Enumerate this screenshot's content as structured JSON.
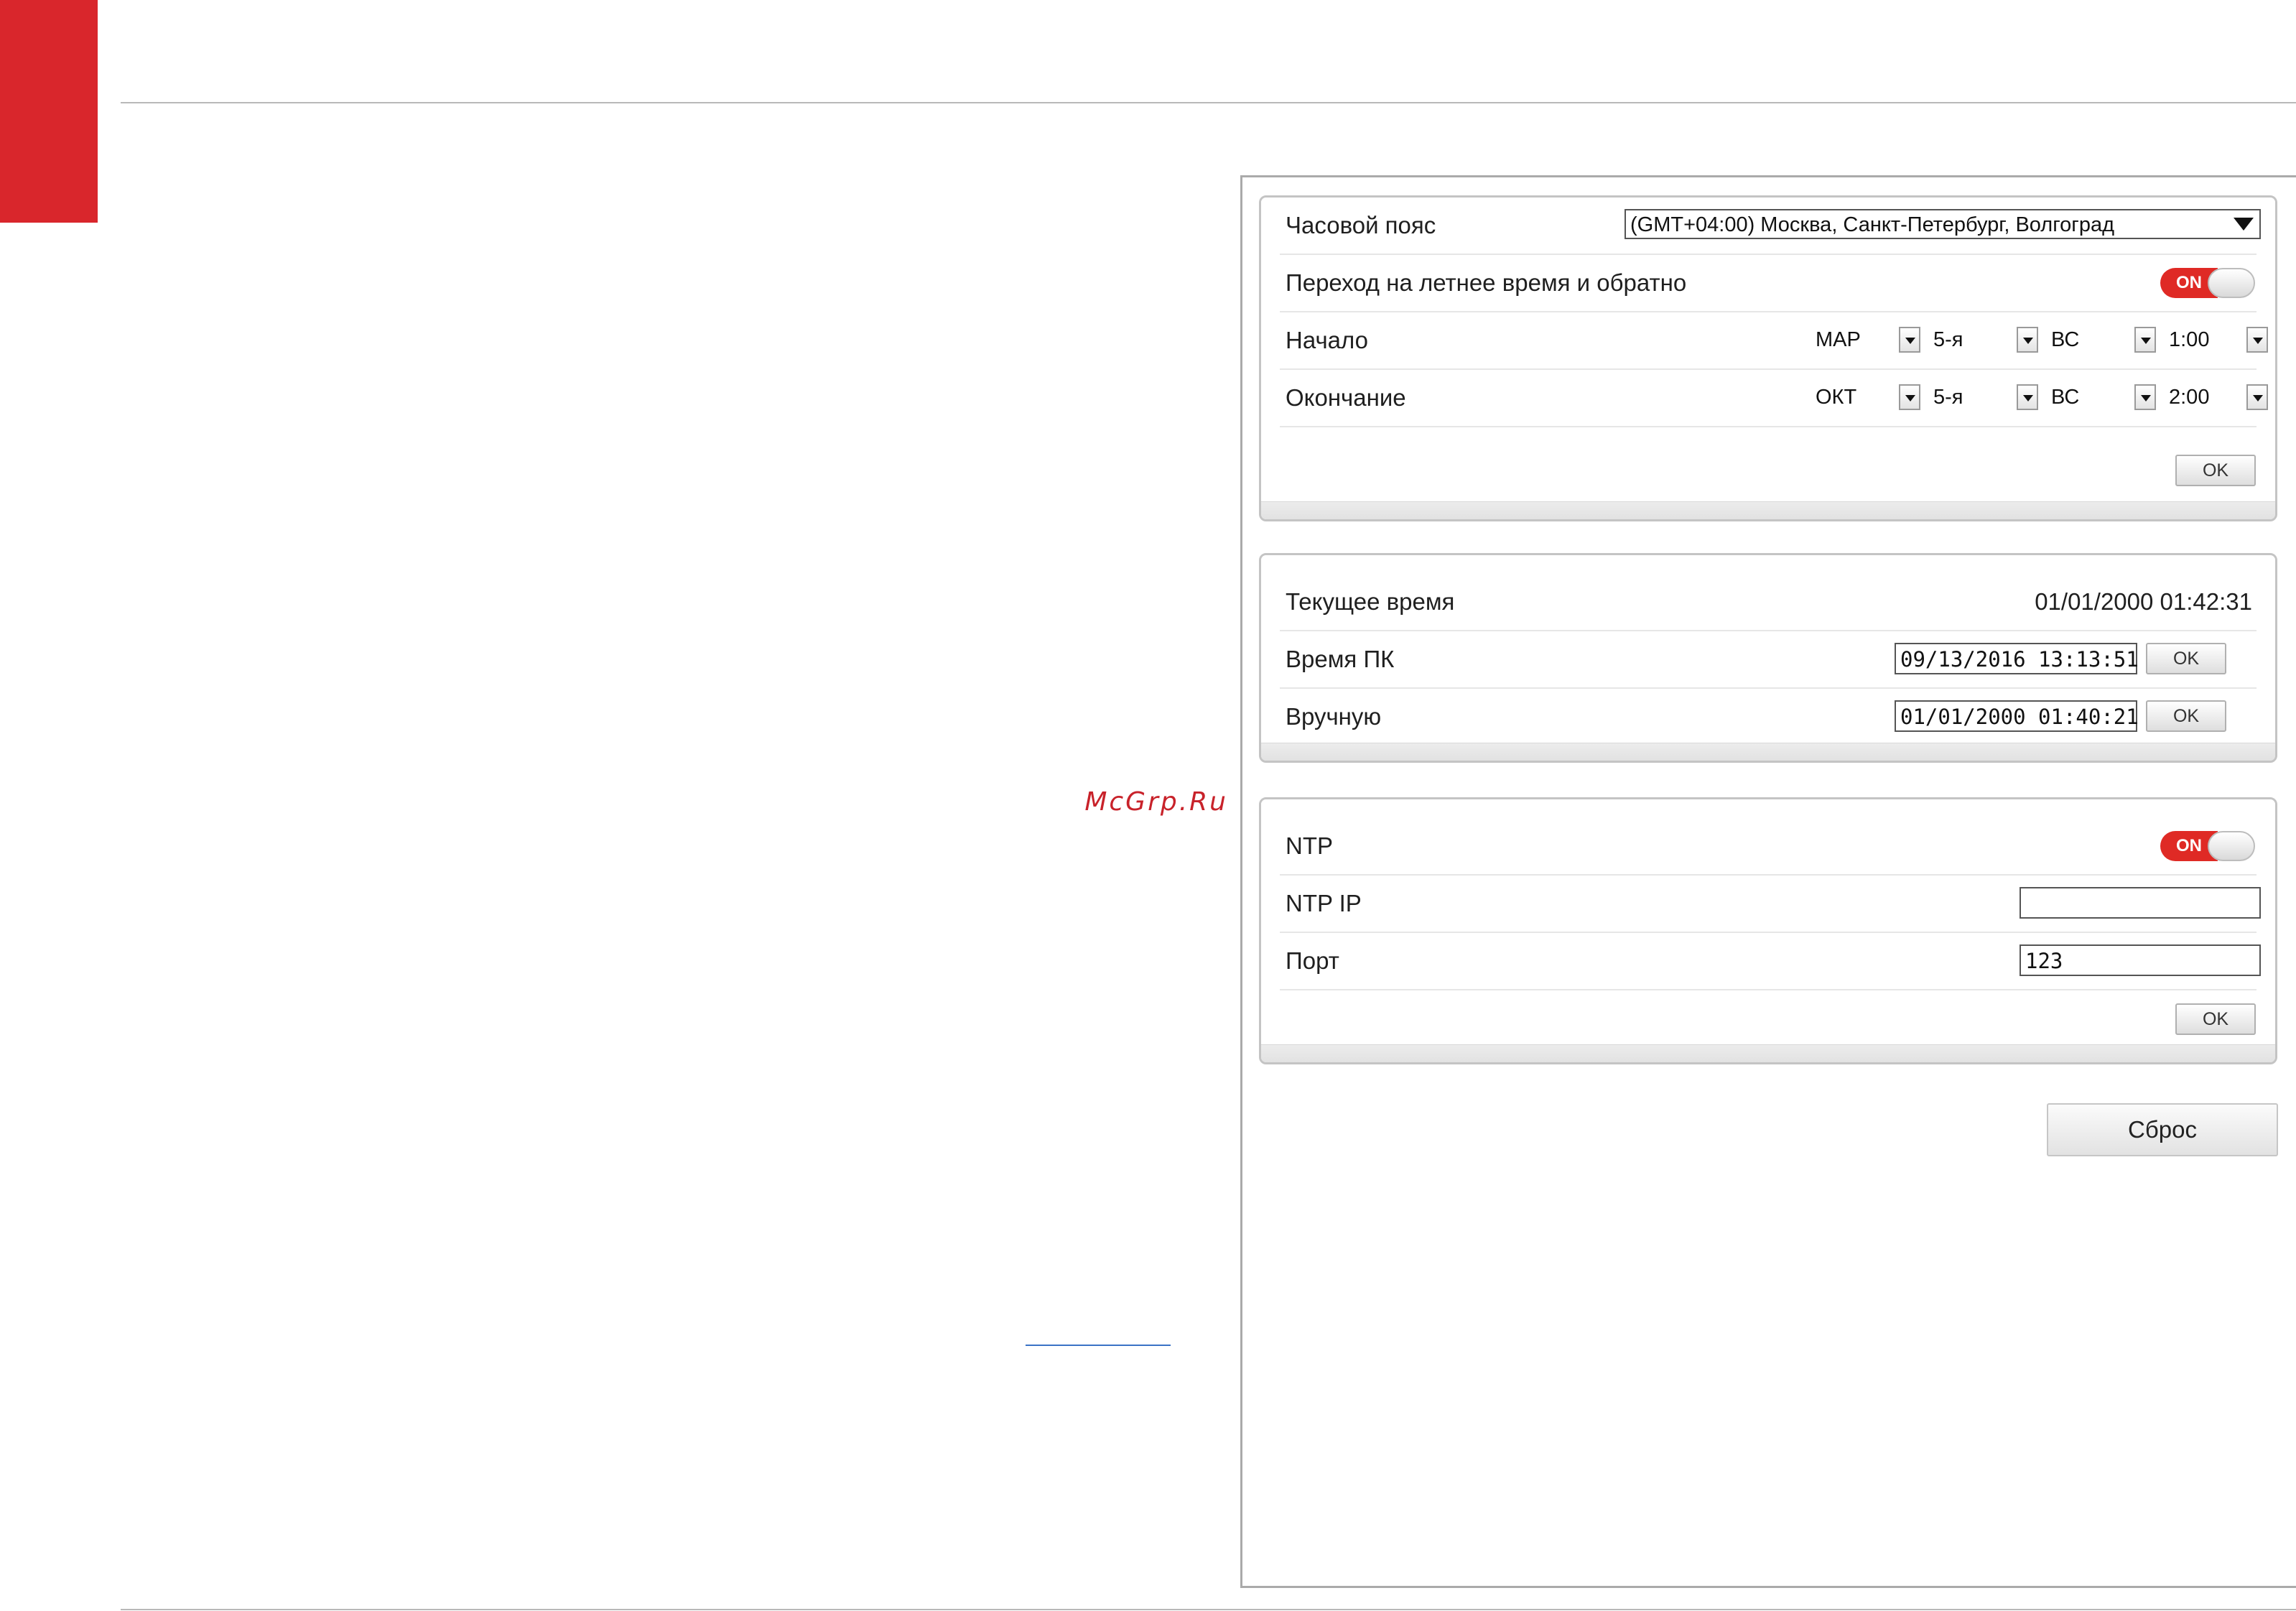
{
  "watermark": "McGrp.Ru",
  "timezone_panel": {
    "timezone_label": "Часовой пояс",
    "timezone_value": "(GMT+04:00) Москва, Санкт-Петербург, Волгоград",
    "dst_label": "Переход на летнее время и обратно",
    "dst_toggle": "ON",
    "start_label": "Начало",
    "start": {
      "month": "МАР",
      "week": "5-я",
      "day": "ВС",
      "time": "1:00"
    },
    "end_label": "Окончание",
    "end": {
      "month": "ОКТ",
      "week": "5-я",
      "day": "ВС",
      "time": "2:00"
    },
    "ok_label": "OK"
  },
  "time_panel": {
    "current_label": "Текущее время",
    "current_value": "01/01/2000 01:42:31",
    "pc_label": "Время ПК",
    "pc_value": "09/13/2016 13:13:51",
    "manual_label": "Вручную",
    "manual_value": "01/01/2000 01:40:21",
    "ok_label": "OK"
  },
  "ntp_panel": {
    "ntp_label": "NTP",
    "ntp_toggle": "ON",
    "ntp_ip_label": "NTP IP",
    "ntp_ip_value": "",
    "port_label": "Порт",
    "port_value": "123",
    "ok_label": "OK"
  },
  "reset_label": "Сброс",
  "colors": {
    "accent_red": "#d9262c",
    "toggle_on": "#df2a25"
  }
}
